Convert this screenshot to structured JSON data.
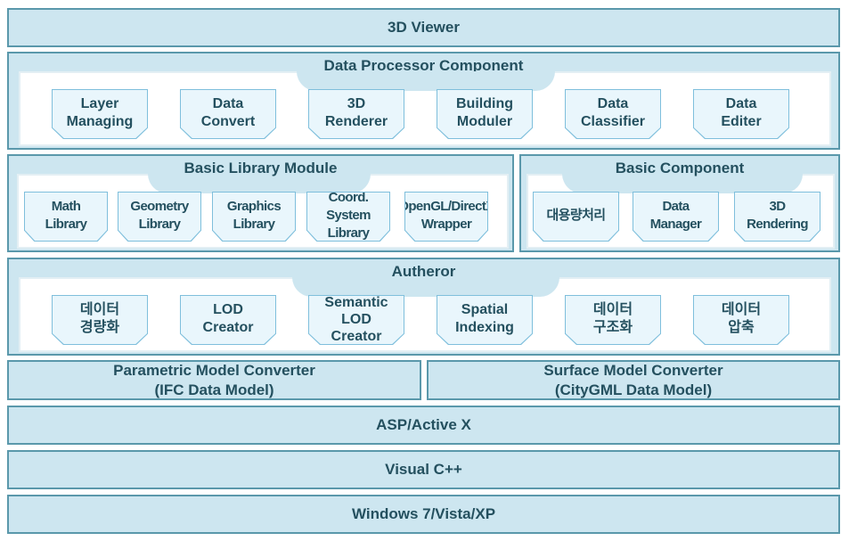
{
  "colors": {
    "layer_fill": "#cde6f0",
    "layer_border": "#5a98ab",
    "box_fill": "#e9f6fc",
    "box_border": "#7fbfdc",
    "text": "#24505f"
  },
  "viewer": "3D Viewer",
  "data_processor": {
    "title": "Data Processor Component",
    "items": [
      "Layer\nManaging",
      "Data\nConvert",
      "3D\nRenderer",
      "Building\nModuler",
      "Data\nClassifier",
      "Data\nEditer"
    ]
  },
  "basic_library": {
    "title": "Basic Library Module",
    "items": [
      "Math\nLibrary",
      "Geometry\nLibrary",
      "Graphics\nLibrary",
      "Coord. System\nLibrary",
      "OpenGL/DirectX\nWrapper"
    ]
  },
  "basic_component": {
    "title": "Basic Component",
    "items": [
      "대용량처리",
      "Data\nManager",
      "3D\nRendering"
    ]
  },
  "autheror": {
    "title": "Autheror",
    "items": [
      "데이터\n경량화",
      "LOD\nCreator",
      "Semantic\nLOD\nCreator",
      "Spatial\nIndexing",
      "데이터\n구조화",
      "데이터\n압축"
    ]
  },
  "parametric": {
    "line1": "Parametric Model Converter",
    "line2": "(IFC Data Model)"
  },
  "surface": {
    "line1": "Surface Model Converter",
    "line2": "(CityGML Data Model)"
  },
  "asp": "ASP/Active X",
  "vcpp": "Visual C++",
  "windows": "Windows 7/Vista/XP"
}
